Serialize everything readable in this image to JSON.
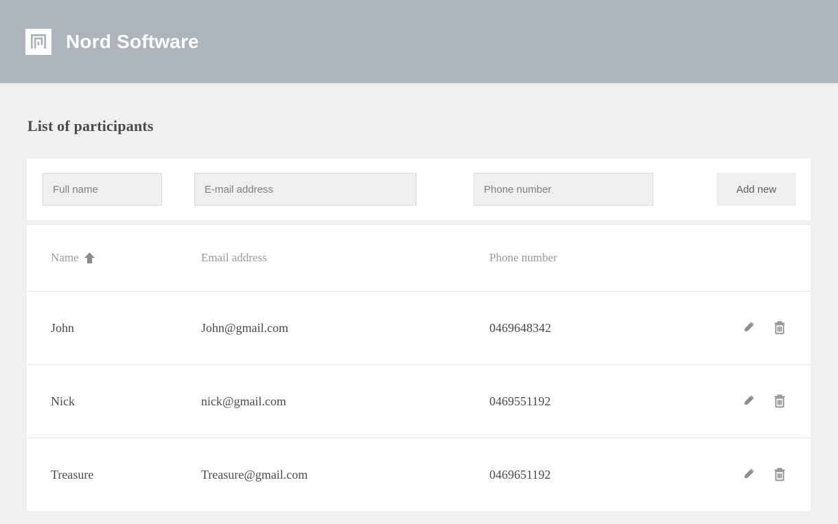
{
  "header": {
    "brand_name": "Nord Software",
    "logo_icon": "nord-logo-icon",
    "bar_color": "#adb4bc",
    "logo_bg": "#ffffff",
    "logo_glyph_color": "#adb4bc"
  },
  "page": {
    "title": "List of participants",
    "background": "#f0f0f0",
    "card_background": "#ffffff"
  },
  "form": {
    "name_placeholder": "Full name",
    "name_value": "",
    "email_placeholder": "E-mail address",
    "email_value": "",
    "phone_placeholder": "Phone number",
    "phone_value": "",
    "add_button_label": "Add new"
  },
  "table": {
    "columns": [
      {
        "label": "Name",
        "sort_icon": "arrow-up-icon",
        "sorted": true
      },
      {
        "label": "Email address",
        "sort_icon": "",
        "sorted": false
      },
      {
        "label": "Phone number",
        "sort_icon": "",
        "sorted": false
      },
      {
        "label": "",
        "sort_icon": "",
        "sorted": false
      }
    ],
    "rows": [
      {
        "name": "John",
        "email": "John@gmail.com",
        "phone": "0469648342",
        "edit_icon": "pencil-icon",
        "delete_icon": "trash-icon"
      },
      {
        "name": "Nick",
        "email": "nick@gmail.com",
        "phone": "0469551192",
        "edit_icon": "pencil-icon",
        "delete_icon": "trash-icon"
      },
      {
        "name": "Treasure",
        "email": "Treasure@gmail.com",
        "phone": "0469651192",
        "edit_icon": "pencil-icon",
        "delete_icon": "trash-icon"
      }
    ],
    "icon_color": "#8c8c8c",
    "border_color": "#e6e6e6"
  }
}
